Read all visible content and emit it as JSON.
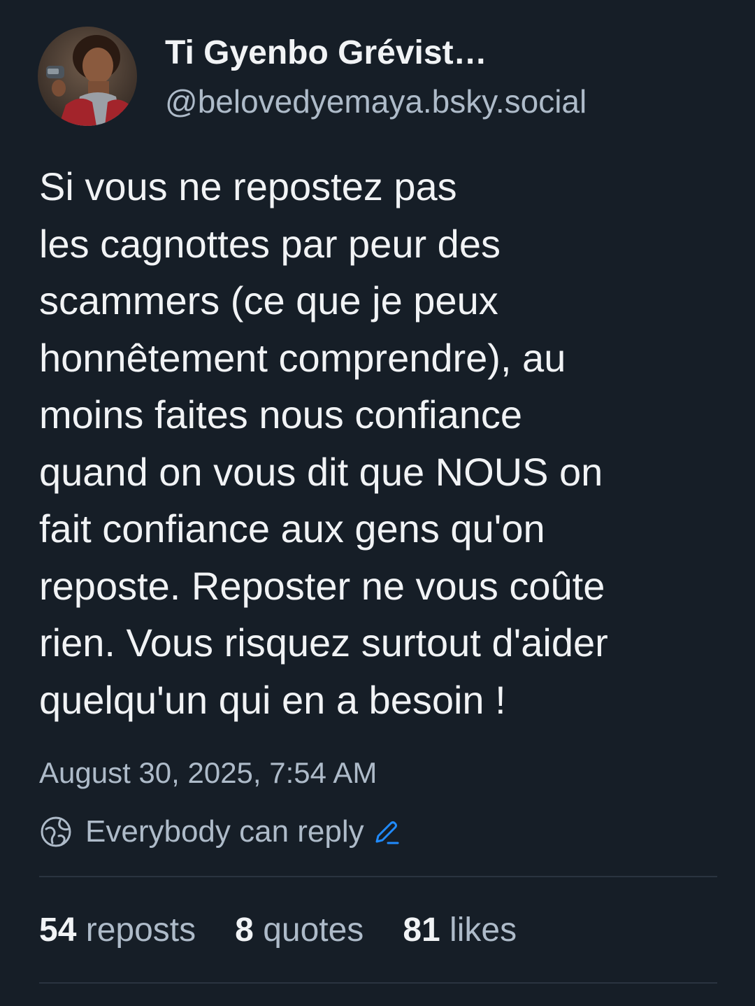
{
  "author": {
    "display_name": "Ti Gyenbo Grévist…",
    "handle": "@belovedyemaya.bsky.social"
  },
  "post": {
    "text": "Si vous ne repostez pas\nles cagnottes par peur des\nscammers (ce que je peux\nhonnêtement comprendre), au\nmoins faites nous confiance\nquand on vous dit que NOUS on\nfait confiance aux gens qu'on\nreposte. Reposter ne vous coûte\nrien. Vous risquez surtout d'aider\nquelqu'un qui en a besoin !",
    "timestamp": "August 30, 2025, 7:54 AM"
  },
  "reply_settings": {
    "label": "Everybody can reply",
    "icon": "globe-icon",
    "edit_icon": "pencil-icon"
  },
  "stats": {
    "reposts_count": "54",
    "reposts_label": "reposts",
    "quotes_count": "8",
    "quotes_label": "quotes",
    "likes_count": "81",
    "likes_label": "likes"
  },
  "colors": {
    "background": "#161e27",
    "text_primary": "#f1f3f5",
    "text_secondary": "#aebbc9",
    "accent": "#208bfe",
    "divider": "#2a3440"
  }
}
